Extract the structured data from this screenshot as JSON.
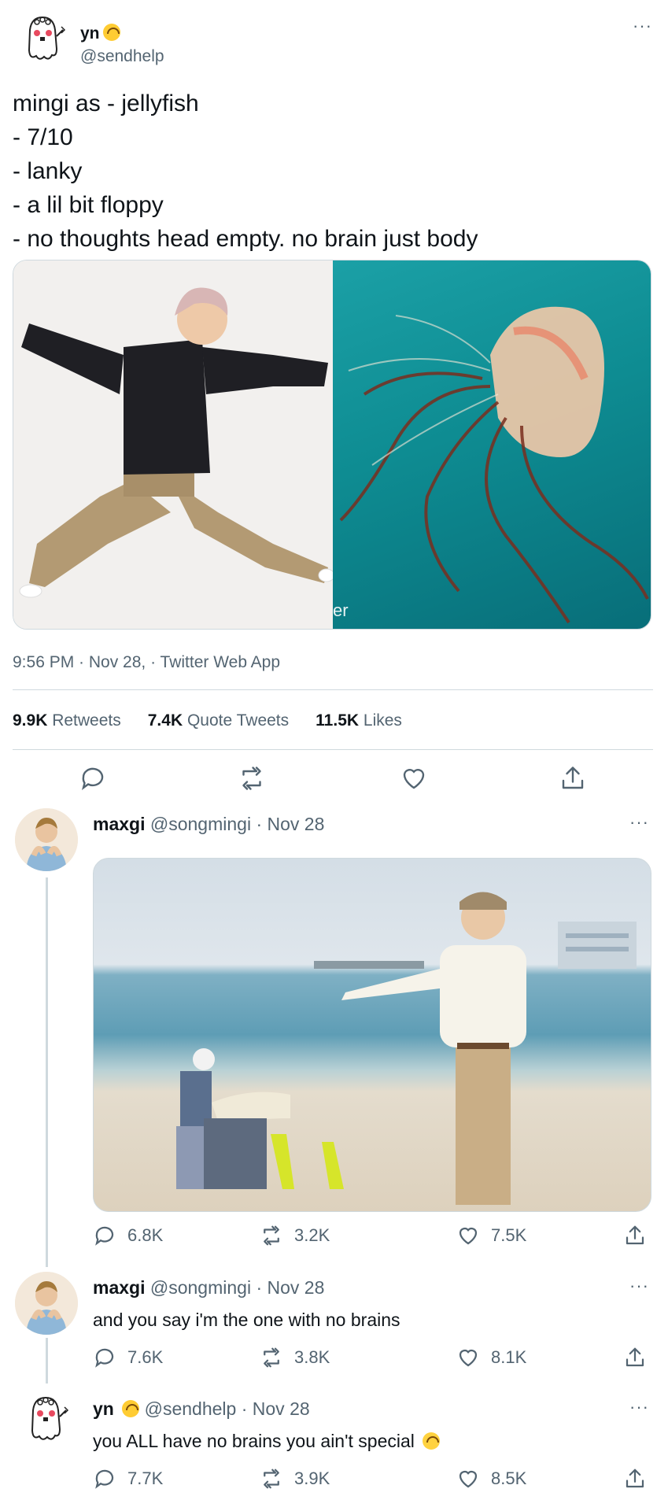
{
  "main": {
    "name": "yn",
    "handle": "@sendhelp",
    "text": "mingi as - jellyfish\n- 7/10\n- lanky\n- a lil bit floppy\n- no thoughts head empty. no brain just body",
    "media_caption": "er",
    "meta": "9:56 PM · Nov 28, · Twitter Web App",
    "stats": {
      "retweets_count": "9.9K",
      "retweets_label": "Retweets",
      "quotes_count": "7.4K",
      "quotes_label": "Quote Tweets",
      "likes_count": "11.5K",
      "likes_label": "Likes"
    }
  },
  "replies": [
    {
      "name": "maxgi",
      "handle": "@songmingi",
      "date": "· Nov 28",
      "text": "",
      "replies": "6.8K",
      "retweets": "3.2K",
      "likes": "7.5K"
    },
    {
      "name": "maxgi",
      "handle": "@songmingi",
      "date": "· Nov 28",
      "text": "and you say i'm the one with no brains",
      "replies": "7.6K",
      "retweets": "3.8K",
      "likes": "8.1K"
    },
    {
      "name": "yn",
      "handle": "@sendhelp",
      "date": "· Nov 28",
      "text": "you ALL have no brains you ain't special",
      "replies": "7.7K",
      "retweets": "3.9K",
      "likes": "8.5K"
    }
  ],
  "more_label": "···",
  "colors": {
    "text": "#0f1419",
    "muted": "#536471",
    "border": "#cfd9de",
    "emoji": "#ffcc33"
  }
}
